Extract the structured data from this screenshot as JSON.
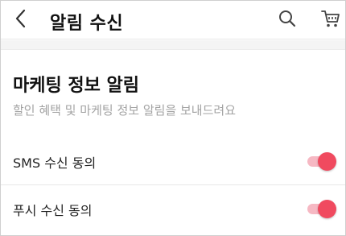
{
  "header": {
    "title": "알림 수신",
    "back_icon": "chevron-left-icon",
    "search_icon": "search-icon",
    "cart_icon": "cart-icon"
  },
  "marketing": {
    "title": "마케팅 정보 알림",
    "description": "할인 혜택 및 마케팅 정보 알림을 보내드려요",
    "settings": [
      {
        "label": "SMS 수신 동의",
        "enabled": true
      },
      {
        "label": "푸시 수신 동의",
        "enabled": true
      }
    ]
  },
  "colors": {
    "toggle_on_knob": "#f04a5f",
    "toggle_on_track": "#f6b8c3",
    "description_text": "#a3a3a3"
  }
}
